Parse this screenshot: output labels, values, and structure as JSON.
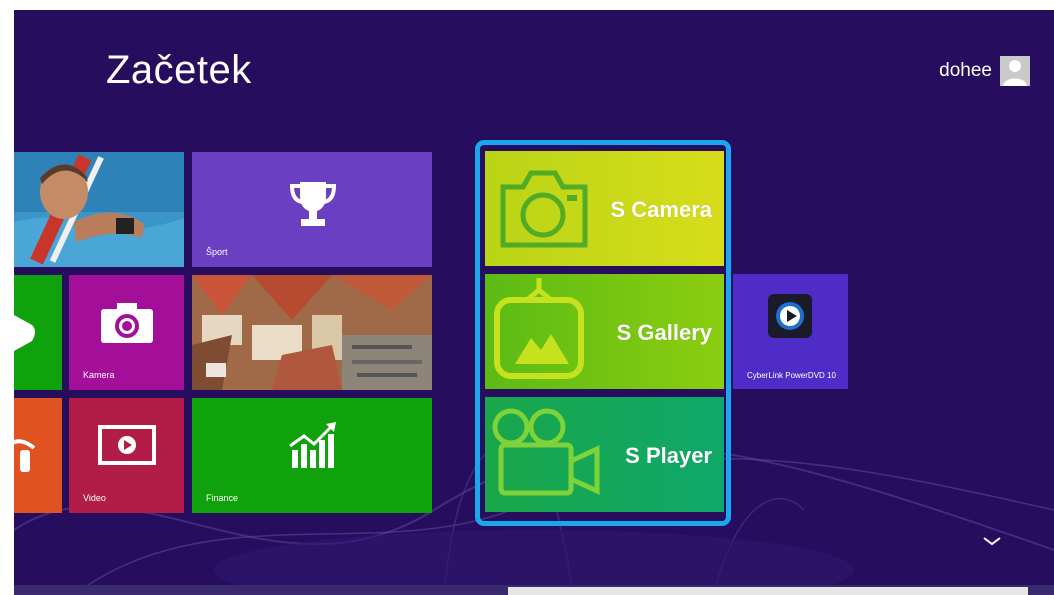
{
  "screen": {
    "title": "Začetek",
    "user": {
      "name": "dohee",
      "avatar_icon": "user-avatar-icon"
    }
  },
  "tiles": {
    "sport": {
      "label": "Šport",
      "icon": "trophy-icon",
      "color": "#6b3fc2"
    },
    "kamera": {
      "label": "Kamera",
      "icon": "camera-icon",
      "color": "#a40f9a"
    },
    "video": {
      "label": "Video",
      "icon": "video-icon",
      "color": "#b11d46"
    },
    "finance": {
      "label": "Finance",
      "icon": "chart-icon",
      "color": "#10a20d"
    },
    "cyberlink": {
      "label": "CyberLink PowerDVD 10",
      "icon": "powerdvd-icon",
      "color": "#4f2cc7"
    },
    "s_camera": {
      "label": "S Camera",
      "icon": "camera-outline-icon",
      "color": "#cfdc15"
    },
    "s_gallery": {
      "label": "S Gallery",
      "icon": "gallery-icon",
      "color": "#72c411"
    },
    "s_player": {
      "label": "S Player",
      "icon": "movie-camera-icon",
      "color": "#12a757"
    }
  },
  "colors": {
    "background": "#270d5e",
    "highlight": "#1aa7f0"
  }
}
